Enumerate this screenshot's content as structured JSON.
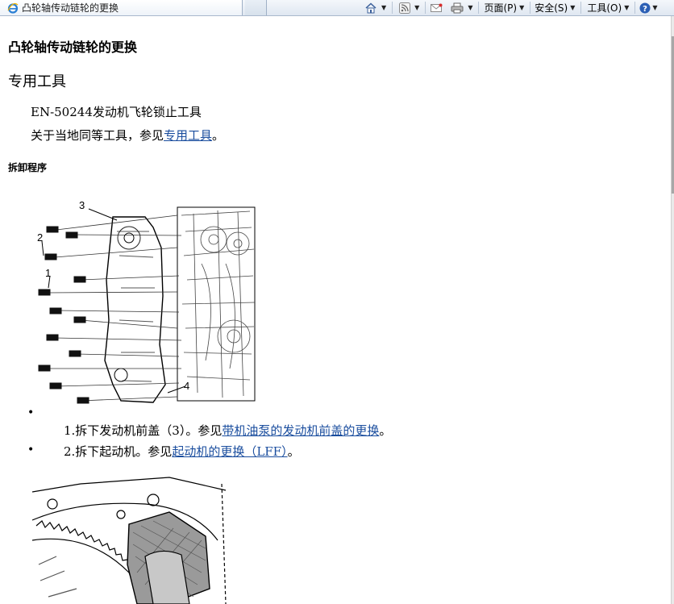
{
  "browser": {
    "tab_title": "凸轮轴传动链轮的更换",
    "toolbar": {
      "page_label": "页面(P)",
      "safety_label": "安全(S)",
      "tools_label": "工具(O)",
      "help_symbol": "?"
    }
  },
  "doc": {
    "title": "凸轮轴传动链轮的更换",
    "special_tools_heading": "专用工具",
    "tool_item": "EN-50244发动机飞轮锁止工具",
    "equivalent_prefix": "关于当地同等工具，参见",
    "equivalent_link": "专用工具",
    "equivalent_suffix": "。",
    "procedure_heading": "拆卸程序",
    "bullet_symbol": "•",
    "steps": [
      {
        "prefix": "1.拆下发动机前盖（3）。参见",
        "link": "带机油泵的发动机前盖的更换",
        "suffix": "。"
      },
      {
        "prefix": "2.拆下起动机。参见",
        "link": "起动机的更换（LFF）",
        "suffix": "。"
      }
    ],
    "figure1_labels": [
      "3",
      "2",
      "1",
      "4"
    ]
  },
  "colors": {
    "link": "#1a4d9e",
    "toolbar_bg": "#dfe7f1"
  }
}
